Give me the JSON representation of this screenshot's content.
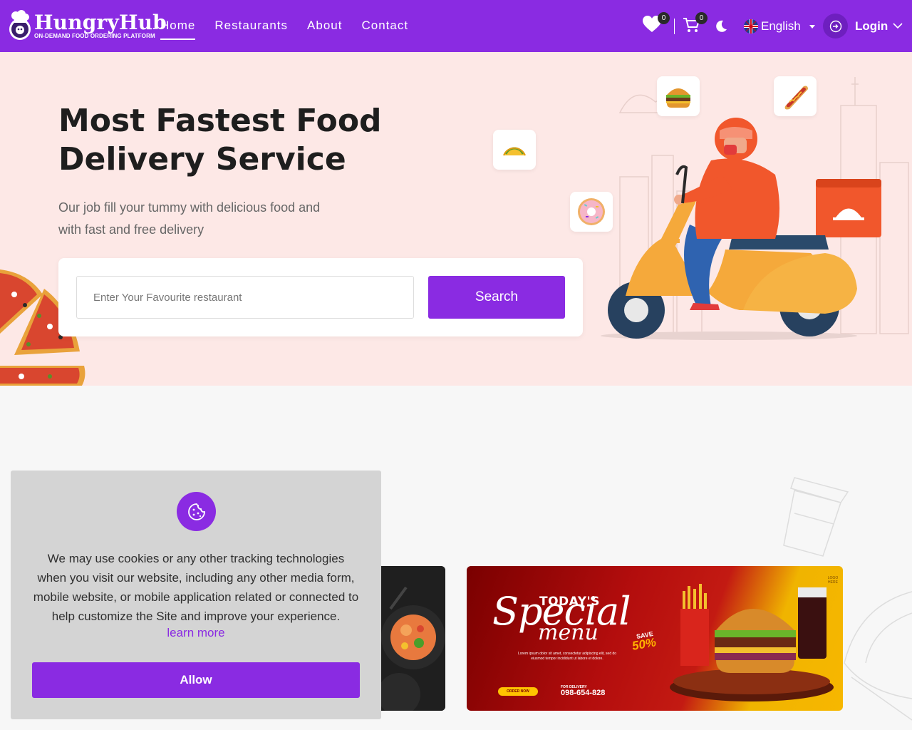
{
  "brand": {
    "name": "HungryHub",
    "tagline": "ON-DEMAND FOOD ORDERING PLATFORM",
    "color": "#8a2be2"
  },
  "nav": {
    "links": [
      {
        "label": "Home",
        "active": true
      },
      {
        "label": "Restaurants",
        "active": false
      },
      {
        "label": "About",
        "active": false
      },
      {
        "label": "Contact",
        "active": false
      }
    ],
    "wishlist_count": "0",
    "cart_count": "0",
    "language": "English",
    "login_label": "Login"
  },
  "hero": {
    "title_line1": "Most Fastest Food",
    "title_line2": "Delivery Service",
    "subtitle_line1": "Our job fill your tummy with delicious food and",
    "subtitle_line2": "with fast and free delivery",
    "search_placeholder": "Enter Your Favourite restaurant",
    "search_value": "",
    "search_button": "Search"
  },
  "promo": {
    "today": "TODAY'S",
    "special": "Special",
    "menu": "menu",
    "save": "SAVE",
    "percent": "50%",
    "lorem": "Lorem ipsum dolor sit amet, consectetur adipiscing elit, sed do eiusmod tempor incididunt ut labore et dolore.",
    "order_now": "ORDER NOW",
    "for_delivery": "FOR DELIVERY",
    "phone": "098-654-828",
    "logo_here": "LOGO HERE"
  },
  "cookie": {
    "message": "We may use cookies or any other tracking technologies when you visit our website, including any other media form, mobile website, or mobile application related or connected to help customize the Site and improve your experience.",
    "learn_more": "learn more",
    "allow": "Allow"
  }
}
